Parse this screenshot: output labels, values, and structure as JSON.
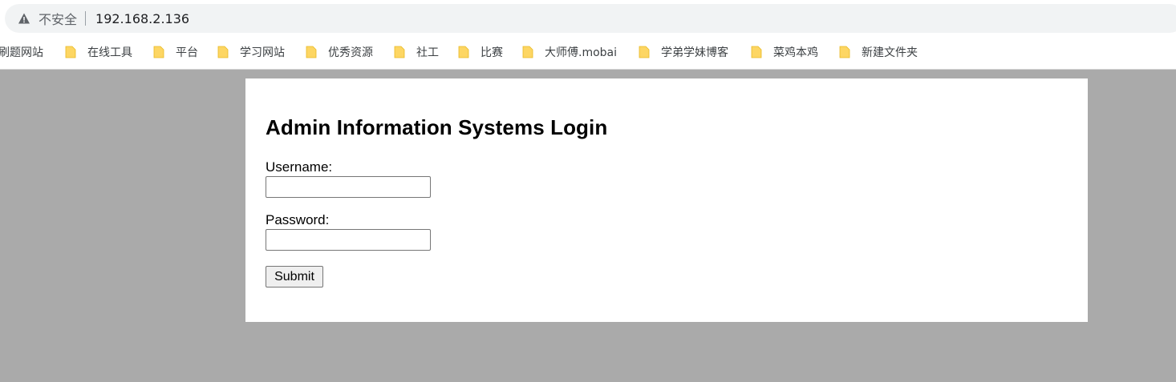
{
  "browser": {
    "security_label": "不安全",
    "url": "192.168.2.136",
    "bookmarks": [
      {
        "label": "刷题网站",
        "has_icon": false
      },
      {
        "label": "在线工具",
        "has_icon": true
      },
      {
        "label": "平台",
        "has_icon": true
      },
      {
        "label": "学习网站",
        "has_icon": true
      },
      {
        "label": "优秀资源",
        "has_icon": true
      },
      {
        "label": "社工",
        "has_icon": true
      },
      {
        "label": "比赛",
        "has_icon": true
      },
      {
        "label": "大师傅.mobai",
        "has_icon": true
      },
      {
        "label": "学弟学妹博客",
        "has_icon": true
      },
      {
        "label": "菜鸡本鸡",
        "has_icon": true
      },
      {
        "label": "新建文件夹",
        "has_icon": true
      }
    ],
    "colors": {
      "folder": "#fdd663",
      "folder_edge": "#e8b923"
    }
  },
  "login": {
    "title": "Admin Information Systems Login",
    "username_label": "Username:",
    "username_value": "",
    "password_label": "Password:",
    "password_value": "",
    "submit_label": "Submit"
  }
}
